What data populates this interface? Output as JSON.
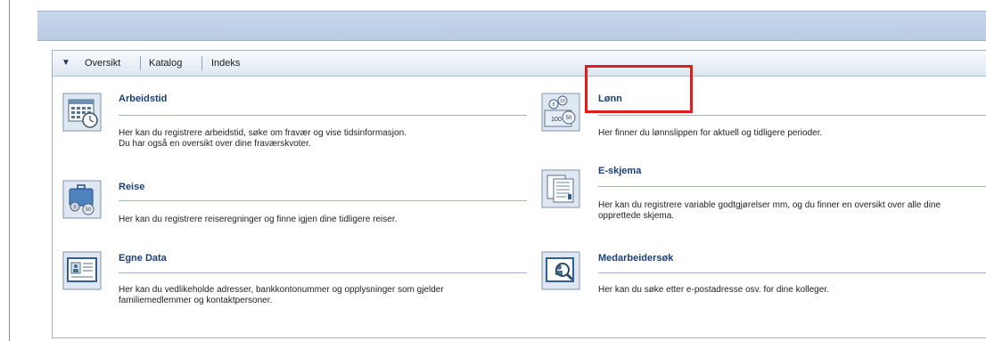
{
  "tabs": [
    {
      "label": "Oversikt"
    },
    {
      "label": "Katalog"
    },
    {
      "label": "Indeks"
    }
  ],
  "left_entries": [
    {
      "title": "Arbeidstid",
      "desc_line1": "Her kan du registrere arbeidstid, søke om fravær og vise tidsinformasjon.",
      "desc_line2": "Du har også en oversikt over dine fraværskvoter."
    },
    {
      "title": "Reise",
      "desc_line1": "Her kan du registrere reiseregninger og finne igjen dine tidligere reiser.",
      "desc_line2": ""
    },
    {
      "title": "Egne Data",
      "desc_line1": "Her kan du vedlikeholde adresser, bankkontonummer og opplysninger som gjelder",
      "desc_line2": "familiemedlemmer og kontaktpersoner."
    }
  ],
  "right_entries": [
    {
      "title": "Lønn",
      "desc_line1": "Her finner du lønnslippen for aktuell og tidligere perioder.",
      "desc_line2": ""
    },
    {
      "title": "E-skjema",
      "desc_line1": "Her kan du registrere variable godtgjørelser mm, og du finner en oversikt over alle dine",
      "desc_line2": "opprettede skjema."
    },
    {
      "title": "Medarbeidersøk",
      "desc_line1": "Her kan du søke etter e-postadresse osv. for dine kolleger.",
      "desc_line2": ""
    }
  ],
  "icons": {
    "arbeidstid": "calendar-clock-icon",
    "reise": "suitcase-money-icon",
    "egne_data": "id-card-icon",
    "lonn": "money-coins-icon",
    "eskjema": "forms-icon",
    "medarbeidersok": "person-search-icon"
  },
  "colors": {
    "title": "#1b3f78",
    "highlight": "#e21b1b",
    "header_band": "#b8cbe1"
  }
}
